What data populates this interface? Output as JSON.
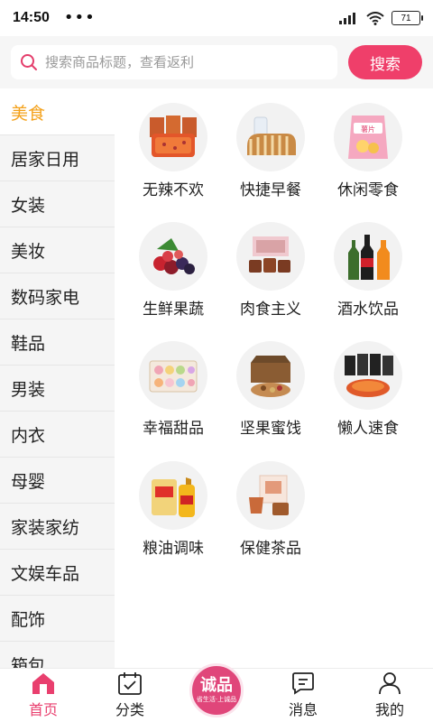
{
  "status": {
    "time": "14:50",
    "dots": "•••",
    "battery": "71"
  },
  "search": {
    "placeholder": "搜索商品标题，查看返利",
    "button": "搜索"
  },
  "sidebar": {
    "items": [
      {
        "label": "美食",
        "active": true
      },
      {
        "label": "居家日用"
      },
      {
        "label": "女装"
      },
      {
        "label": "美妆"
      },
      {
        "label": "数码家电"
      },
      {
        "label": "鞋品"
      },
      {
        "label": "男装"
      },
      {
        "label": "内衣"
      },
      {
        "label": "母婴"
      },
      {
        "label": "家装家纺"
      },
      {
        "label": "文娱车品"
      },
      {
        "label": "配饰"
      },
      {
        "label": "箱包"
      }
    ]
  },
  "categories": [
    {
      "label": "无辣不欢",
      "icon": "spicy-snack-icon"
    },
    {
      "label": "快捷早餐",
      "icon": "bread-icon"
    },
    {
      "label": "休闲零食",
      "icon": "chips-bag-icon"
    },
    {
      "label": "生鲜果蔬",
      "icon": "berries-icon"
    },
    {
      "label": "肉食主义",
      "icon": "meat-box-icon"
    },
    {
      "label": "酒水饮品",
      "icon": "bottles-icon"
    },
    {
      "label": "幸福甜品",
      "icon": "macaron-icon"
    },
    {
      "label": "坚果蜜饯",
      "icon": "nuts-box-icon"
    },
    {
      "label": "懒人速食",
      "icon": "instant-food-icon"
    },
    {
      "label": "粮油调味",
      "icon": "rice-oil-icon"
    },
    {
      "label": "保健茶品",
      "icon": "tea-icon"
    }
  ],
  "bottom_nav": {
    "home": "首页",
    "category": "分类",
    "center_badge": "诚品",
    "center_badge_sub": "省生活·上诚品",
    "messages": "消息",
    "mine": "我的"
  },
  "colors": {
    "accent": "#ef3f6a",
    "active_side": "#f4a11a",
    "nav_active": "#e93f6e"
  }
}
